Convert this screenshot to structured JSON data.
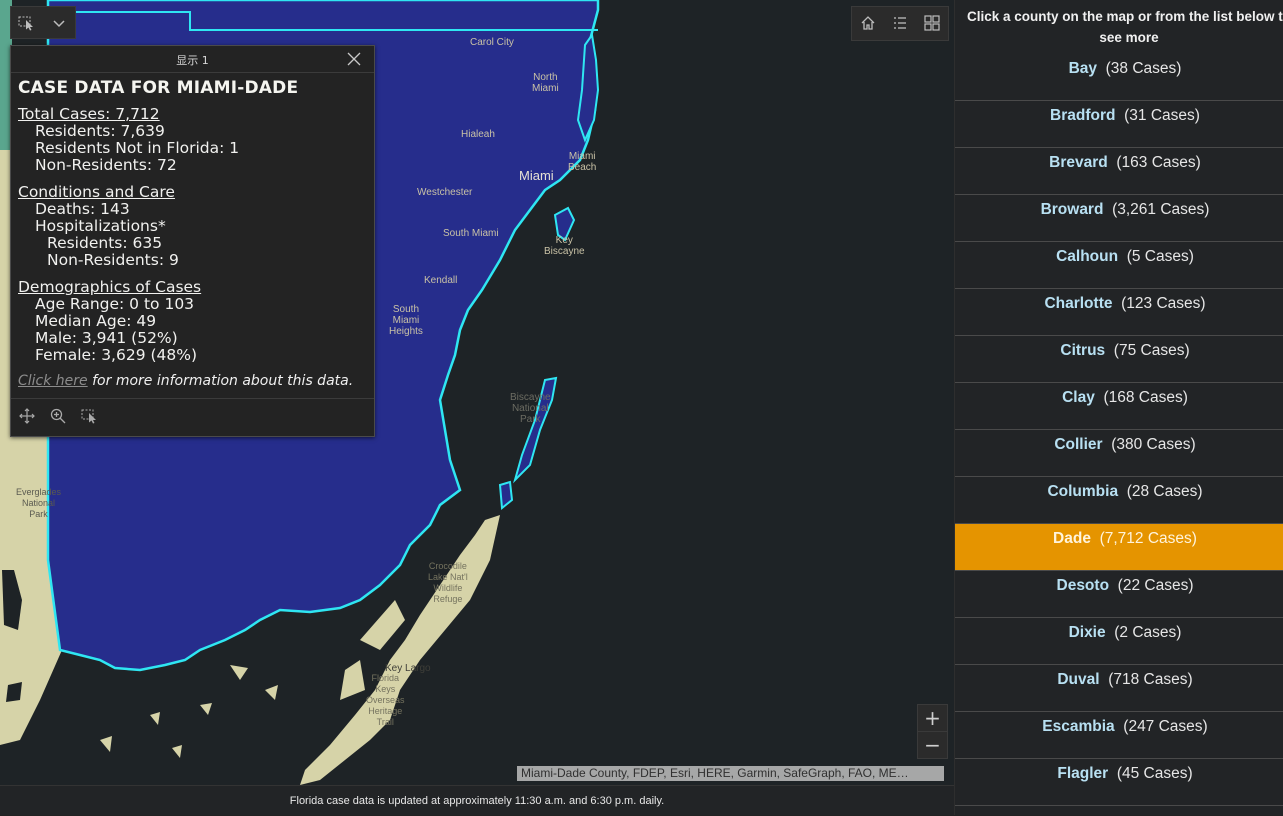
{
  "popup": {
    "window_title": "显示 1",
    "heading": "CASE DATA FOR MIAMI-DADE",
    "total_cases": "Total Cases: 7,712",
    "residents": "Residents: 7,639",
    "residents_not_fl": "Residents Not in Florida: 1",
    "non_residents": "Non-Residents: 72",
    "conditions_heading": "Conditions and Care",
    "deaths": "Deaths: 143",
    "hospitalizations": "Hospitalizations*",
    "hosp_residents": "Residents: 635",
    "hosp_non_residents": "Non-Residents: 9",
    "demographics_heading": "Demographics of Cases",
    "age_range": "Age Range: 0 to 103",
    "median_age": "Median Age: 49",
    "male": "Male: 3,941 (52%)",
    "female": "Female: 3,629 (48%)",
    "click_here": "Click here",
    "click_rest": " for more information about this data."
  },
  "map": {
    "places": {
      "carol_city": "Carol City",
      "north_miami": "North\nMiami",
      "hialeah": "Hialeah",
      "miami_beach": "Miami\nBeach",
      "miami": "Miami",
      "westchester": "Westchester",
      "south_miami": "South Miami",
      "key_biscayne": "Key\nBiscayne",
      "kendall": "Kendall",
      "south_miami_heights": "South\nMiami\nHeights",
      "biscayne_np": "Biscayne\nNational\nPark",
      "everglades_np": "Everglades\nNational\nPark",
      "crocodile_lake": "Crocodile\nLake Nat'l\nWildlife\nRefuge",
      "key_largo": "Key Largo",
      "florida_keys_trail": "Florida\nKeys\nOverseas\nHeritage\nTrail"
    },
    "attribution": "Miami-Dade County, FDEP, Esri, HERE, Garmin, SafeGraph, FAO, ME…",
    "zoom_in": "+",
    "zoom_out": "−",
    "colors": {
      "county_fill": "#262d8c",
      "county_outline": "#2fe6f2",
      "water": "#1e2326",
      "land": "#d6d3a8"
    }
  },
  "footer": "Florida case data is updated at approximately 11:30 a.m. and 6:30 p.m. daily.",
  "sidebar": {
    "intro": "Click a county on the map or from the list below to see more",
    "counties": [
      {
        "name": "Bay",
        "cases": "(38 Cases)"
      },
      {
        "name": "Bradford",
        "cases": "(31 Cases)"
      },
      {
        "name": "Brevard",
        "cases": "(163 Cases)"
      },
      {
        "name": "Broward",
        "cases": "(3,261 Cases)"
      },
      {
        "name": "Calhoun",
        "cases": "(5 Cases)"
      },
      {
        "name": "Charlotte",
        "cases": "(123 Cases)"
      },
      {
        "name": "Citrus",
        "cases": "(75 Cases)"
      },
      {
        "name": "Clay",
        "cases": "(168 Cases)"
      },
      {
        "name": "Collier",
        "cases": "(380 Cases)"
      },
      {
        "name": "Columbia",
        "cases": "(28 Cases)"
      },
      {
        "name": "Dade",
        "cases": "(7,712 Cases)",
        "selected": true
      },
      {
        "name": "Desoto",
        "cases": "(22 Cases)"
      },
      {
        "name": "Dixie",
        "cases": "(2 Cases)"
      },
      {
        "name": "Duval",
        "cases": "(718 Cases)"
      },
      {
        "name": "Escambia",
        "cases": "(247 Cases)"
      },
      {
        "name": "Flagler",
        "cases": "(45 Cases)"
      }
    ],
    "colors": {
      "selected_bg": "#e59400",
      "name": "#b8e0f2"
    }
  }
}
